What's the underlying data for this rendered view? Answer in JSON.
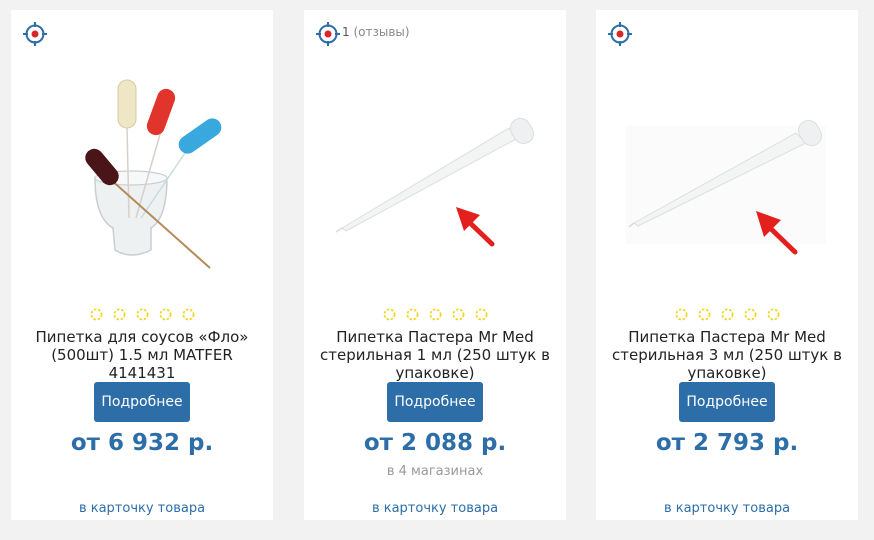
{
  "accent_color": "#2d6ea8",
  "icons": {
    "target": "target-icon",
    "star": "star-outline-icon",
    "arrow": "red-arrow-icon"
  },
  "products": [
    {
      "title": "Пипетка для соусов «Фло» (500шт) 1.5 мл MATFER 4141431",
      "button_label": "Подробнее",
      "price": "от 6 932 р.",
      "link": "в карточку товара",
      "rating": 0
    },
    {
      "review_count": "1",
      "review_label": "(отзывы)",
      "title": "Пипетка Пастера Mr Med стерильная 1 мл (250 штук в упаковке)",
      "button_label": "Подробнее",
      "price": "от 2 088 р.",
      "shops": "в 4 магазинах",
      "link": "в карточку товара",
      "rating": 0
    },
    {
      "title": "Пипетка Пастера Mr Med стерильная 3 мл (250 штук в упаковке)",
      "button_label": "Подробнее",
      "price": "от 2 793 р.",
      "link": "в карточку товара",
      "rating": 0
    }
  ]
}
